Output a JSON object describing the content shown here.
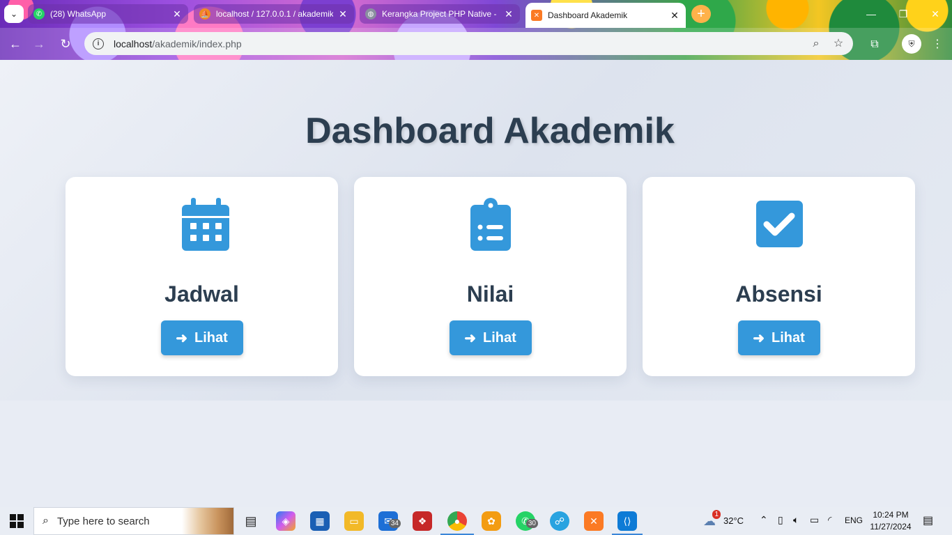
{
  "browser": {
    "tabs": [
      {
        "title": "(28) WhatsApp",
        "favicon": "whatsapp-icon",
        "active": false
      },
      {
        "title": "localhost / 127.0.0.1 / akademik",
        "favicon": "phpmyadmin-icon",
        "active": false
      },
      {
        "title": "Kerangka Project PHP Native -",
        "favicon": "globe-icon",
        "active": false
      },
      {
        "title": "Dashboard Akademik",
        "favicon": "xampp-icon",
        "active": true
      }
    ],
    "url_host": "localhost",
    "url_path": "/akademik/index.php"
  },
  "page": {
    "title": "Dashboard Akademik",
    "cards": [
      {
        "title": "Jadwal",
        "icon": "calendar-icon",
        "button": "Lihat"
      },
      {
        "title": "Nilai",
        "icon": "clipboard-list-icon",
        "button": "Lihat"
      },
      {
        "title": "Absensi",
        "icon": "check-square-icon",
        "button": "Lihat"
      }
    ],
    "accent_color": "#3498db",
    "text_color": "#2c3e50"
  },
  "taskbar": {
    "search_placeholder": "Type here to search",
    "mail_badge": "34",
    "whatsapp_badge": "30",
    "weather_alert": "1",
    "temperature": "32°C",
    "language": "ENG",
    "time": "10:24 PM",
    "date": "11/27/2024"
  }
}
